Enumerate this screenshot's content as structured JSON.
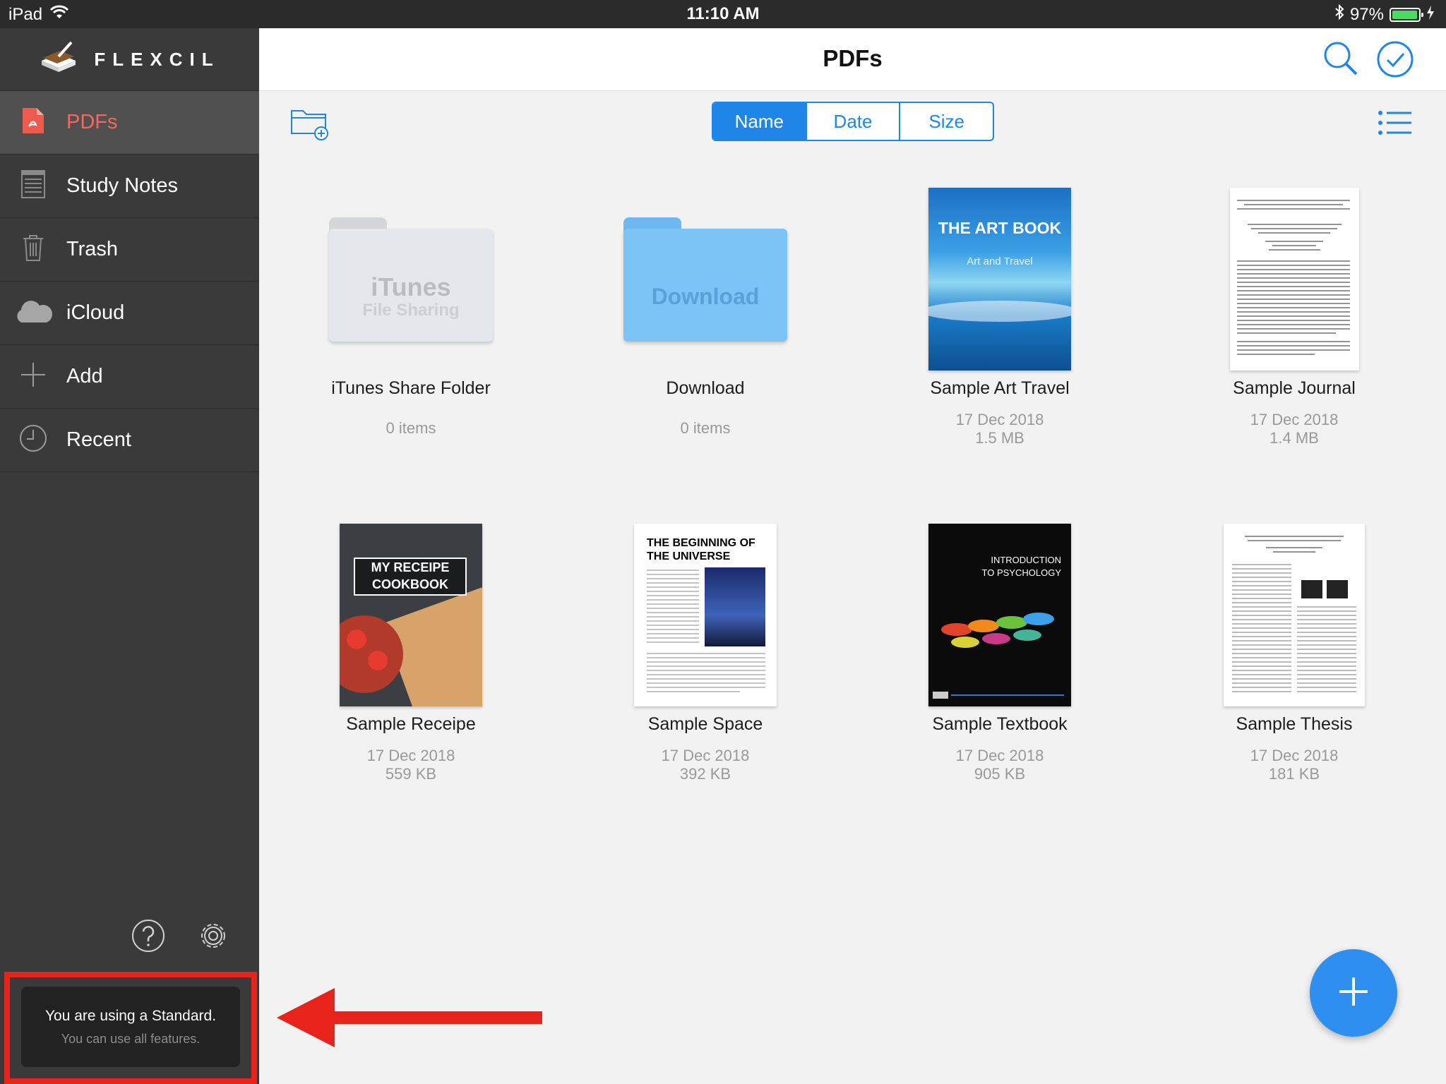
{
  "status_bar": {
    "device": "iPad",
    "time": "11:10 AM",
    "battery": "97%",
    "battery_level": 0.97
  },
  "sidebar": {
    "brand": "FLEXCIL",
    "items": [
      {
        "label": "PDFs",
        "icon": "pdf-icon",
        "active": true
      },
      {
        "label": "Study Notes",
        "icon": "notes-icon"
      },
      {
        "label": "Trash",
        "icon": "trash-icon"
      },
      {
        "label": "iCloud",
        "icon": "cloud-icon"
      },
      {
        "label": "Add",
        "icon": "plus-icon"
      },
      {
        "label": "Recent",
        "icon": "clock-icon"
      }
    ],
    "notice_title": "You are using a Standard.",
    "notice_sub": "You can use all features."
  },
  "header": {
    "title": "PDFs"
  },
  "sort": {
    "options": [
      "Name",
      "Date",
      "Size"
    ],
    "selected": "Name"
  },
  "folders": [
    {
      "name": "iTunes Share Folder",
      "meta": "0 items",
      "label_top": "iTunes",
      "label_bottom": "File Sharing"
    },
    {
      "name": "Download",
      "meta": "0 items",
      "label_top": "Download"
    }
  ],
  "documents": [
    {
      "name": "Sample Art Travel",
      "date": "17 Dec 2018",
      "size": "1.5 MB",
      "cover_title": "THE ART BOOK",
      "cover_sub": "Art and Travel"
    },
    {
      "name": "Sample Journal",
      "date": "17 Dec 2018",
      "size": "1.4 MB"
    },
    {
      "name": "Sample Receipe",
      "date": "17 Dec 2018",
      "size": "559 KB",
      "cover_title": "MY RECEIPE",
      "cover_sub": "COOKBOOK"
    },
    {
      "name": "Sample Space",
      "date": "17 Dec 2018",
      "size": "392 KB",
      "cover_title": "THE BEGINNING OF",
      "cover_sub": "THE UNIVERSE"
    },
    {
      "name": "Sample Textbook",
      "date": "17 Dec 2018",
      "size": "905 KB",
      "cover_title": "INTRODUCTION",
      "cover_sub": "TO PSYCHOLOGY"
    },
    {
      "name": "Sample Thesis",
      "date": "17 Dec 2018",
      "size": "181 KB"
    }
  ],
  "colors": {
    "accent": "#1f86e8",
    "active_nav": "#f26a5e",
    "sidebar_bg": "#3a3a3a",
    "highlight": "#e8231c"
  }
}
